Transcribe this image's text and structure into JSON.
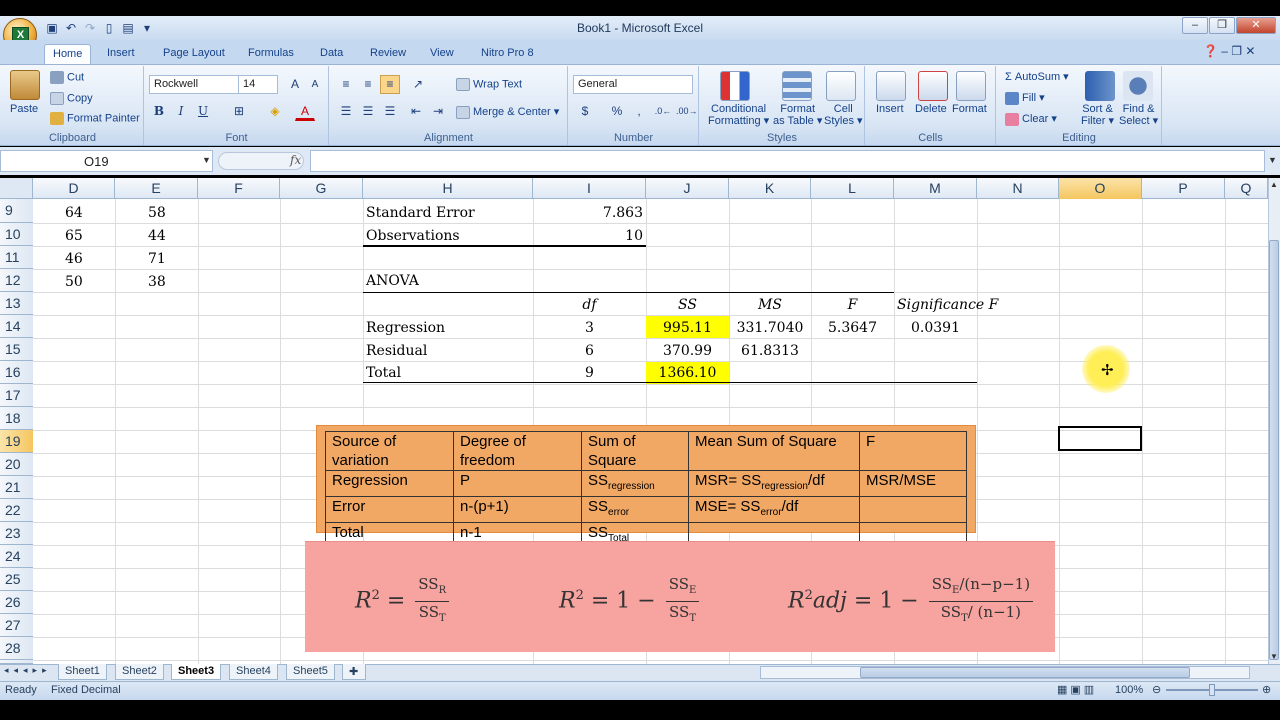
{
  "window": {
    "title": "Book1 - Microsoft Excel"
  },
  "tabs": [
    "Home",
    "Insert",
    "Page Layout",
    "Formulas",
    "Data",
    "Review",
    "View",
    "Nitro Pro 8"
  ],
  "ribbon": {
    "clipboard": {
      "paste": "Paste",
      "cut": "Cut",
      "copy": "Copy",
      "format_painter": "Format Painter",
      "group": "Clipboard"
    },
    "font": {
      "family": "Rockwell",
      "size": "14",
      "group": "Font",
      "bold": "B",
      "italic": "I",
      "underline": "U",
      "grow": "A",
      "shrink": "A"
    },
    "alignment": {
      "wrap": "Wrap Text",
      "merge": "Merge & Center",
      "group": "Alignment"
    },
    "number": {
      "format": "General",
      "currency": "$",
      "percent": "%",
      "comma": ",",
      "group": "Number"
    },
    "styles": {
      "conditional": "Conditional",
      "conditional2": "Formatting",
      "format_table": "Format",
      "format_table2": "as Table",
      "cell_styles": "Cell",
      "cell_styles2": "Styles",
      "group": "Styles"
    },
    "cells": {
      "insert": "Insert",
      "delete": "Delete",
      "format": "Format",
      "group": "Cells"
    },
    "editing": {
      "autosum": "AutoSum",
      "fill": "Fill",
      "clear": "Clear",
      "sort": "Sort &",
      "sort2": "Filter",
      "find": "Find &",
      "find2": "Select",
      "group": "Editing"
    }
  },
  "formula_bar": {
    "name_box": "O19",
    "fx": "fx",
    "formula": ""
  },
  "columns": [
    "D",
    "E",
    "F",
    "G",
    "H",
    "I",
    "J",
    "K",
    "L",
    "M",
    "N",
    "O",
    "P",
    "Q"
  ],
  "rows": [
    "9",
    "10",
    "11",
    "12",
    "13",
    "14",
    "15",
    "16",
    "17",
    "18",
    "19",
    "20",
    "21",
    "22",
    "23",
    "24",
    "25",
    "26",
    "27",
    "28",
    "29"
  ],
  "data_de": [
    [
      "64",
      "58"
    ],
    [
      "65",
      "44"
    ],
    [
      "46",
      "71"
    ],
    [
      "50",
      "38"
    ]
  ],
  "summary": {
    "std_error_label": "Standard Error",
    "std_error": "7.863",
    "obs_label": "Observations",
    "obs": "10"
  },
  "anova": {
    "title": "ANOVA",
    "headers": [
      "df",
      "SS",
      "MS",
      "F",
      "Significance F"
    ],
    "rows": [
      {
        "label": "Regression",
        "df": "3",
        "ss": "995.11",
        "ms": "331.7040",
        "f": "5.3647",
        "sig": "0.0391"
      },
      {
        "label": "Residual",
        "df": "6",
        "ss": "370.99",
        "ms": "61.8313",
        "f": "",
        "sig": ""
      },
      {
        "label": "Total",
        "df": "9",
        "ss": "1366.10",
        "ms": "",
        "f": "",
        "sig": ""
      }
    ],
    "highlight": "#ffff00"
  },
  "reference_table": {
    "headers": [
      "Source of variation",
      "Degree of freedom",
      "Sum of Square",
      "Mean Sum of Square",
      "F"
    ],
    "rows": [
      {
        "source": "Regression",
        "dof": "P",
        "ss": "SS",
        "ss_sub": "regression",
        "msq": "MSR= SS",
        "msq_sub": "regression",
        "msq_tail": "/df",
        "f": "MSR/MSE"
      },
      {
        "source": "Error",
        "dof": "n-(p+1)",
        "ss": "SS",
        "ss_sub": "error",
        "msq": "MSE= SS",
        "msq_sub": "error",
        "msq_tail": "/df",
        "f": ""
      },
      {
        "source": "Total",
        "dof": "n-1",
        "ss": "SS",
        "ss_sub": "Total",
        "msq": "",
        "msq_sub": "",
        "msq_tail": "",
        "f": ""
      }
    ]
  },
  "formulas": {
    "f1_lhs": "R",
    "f1_num": "SS",
    "f1_num_sub": "R",
    "f1_den": "SS",
    "f1_den_sub": "T",
    "f2_lhs": "R",
    "f2_mid": "= 1 −",
    "f2_num": "SS",
    "f2_num_sub": "E",
    "f2_den": "SS",
    "f2_den_sub": "T",
    "f3_lhs": "R",
    "f3_adj": "adj",
    "f3_mid": "= 1 −",
    "f3_num": "SS",
    "f3_num_sub": "E",
    "f3_num_tail": "/(n−p−1)",
    "f3_den": "SS",
    "f3_den_sub": "T",
    "f3_den_tail": "/ (n−1)"
  },
  "sheets": [
    "Sheet1",
    "Sheet2",
    "Sheet3",
    "Sheet4",
    "Sheet5"
  ],
  "active_sheet": "Sheet3",
  "status": {
    "ready": "Ready",
    "mode": "Fixed Decimal",
    "zoom": "100%"
  }
}
